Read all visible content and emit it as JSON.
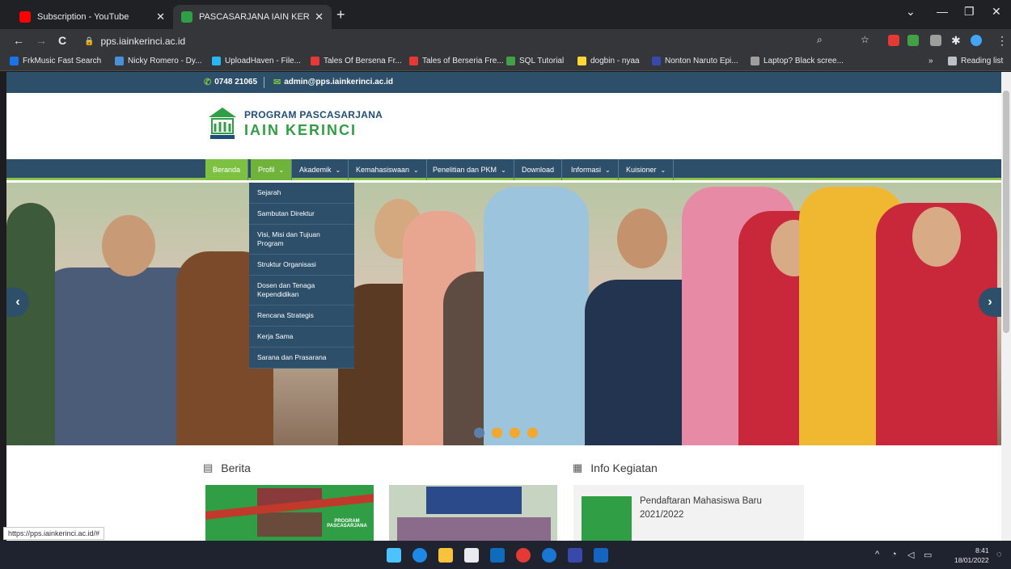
{
  "browser": {
    "tabs": [
      {
        "title": "Subscription - YouTube",
        "active": false
      },
      {
        "title": "PASCASARJANA IAIN KERINCI",
        "active": true
      }
    ],
    "new_tab": "+",
    "window_controls": {
      "minimize": "—",
      "maximize": "❐",
      "close": "✕",
      "overflow": "⌄"
    },
    "nav": {
      "back": "←",
      "forward": "→",
      "reload": "C"
    },
    "url": "pps.iainkerinci.ac.id",
    "bookmarks": [
      {
        "label": "FrkMusic Fast Search",
        "color": "#1a73e8"
      },
      {
        "label": "Nicky Romero - Dy...",
        "color": "#4a90d9"
      },
      {
        "label": "UploadHaven - File...",
        "color": "#29b6f6"
      },
      {
        "label": "Tales Of Bersena Fr...",
        "color": "#e53935"
      },
      {
        "label": "Tales of Berseria Fre...",
        "color": "#e53935"
      },
      {
        "label": "SQL Tutorial",
        "color": "#43a047"
      },
      {
        "label": "dogbin - nyaa",
        "color": "#fdd835"
      },
      {
        "label": "Nonton Naruto Epi...",
        "color": "#3949ab"
      },
      {
        "label": "Laptop? Black scree...",
        "color": "#9e9e9e"
      }
    ],
    "bookmarks_more": "»",
    "reading_list": "Reading list"
  },
  "site": {
    "phone": "0748 21065",
    "email": "admin@pps.iainkerinci.ac.id",
    "logo": {
      "line1": "PROGRAM PASCASARJANA",
      "line2": "IAIN KERINCI"
    },
    "nav": [
      {
        "label": "Beranda",
        "caret": false
      },
      {
        "label": "Profil",
        "caret": true
      },
      {
        "label": "Akademik",
        "caret": true
      },
      {
        "label": "Kemahasiswaan",
        "caret": true
      },
      {
        "label": "Penelitian dan PKM",
        "caret": true
      },
      {
        "label": "Download",
        "caret": false
      },
      {
        "label": "Informasi",
        "caret": true
      },
      {
        "label": "Kuisioner",
        "caret": true
      }
    ],
    "caret_glyph": "⌄",
    "profil_menu": [
      "Sejarah",
      "Sambutan Direktur",
      "Visi, Misi dan Tujuan Program",
      "Struktur Organisasi",
      "Dosen dan Tenaga Kependidikan",
      "Rencana Strategis",
      "Kerja Sama",
      "Sarana dan Prasarana"
    ],
    "carousel": {
      "prev": "‹",
      "next": "›",
      "slides": 4,
      "active_slide": 1
    },
    "berita_title": "Berita",
    "info_title": "Info Kegiatan",
    "info_items": [
      {
        "title": "Pendaftaran Mahasiswa Baru 2021/2022"
      }
    ],
    "thumb_caption": "PROGRAM PASCASARJANA"
  },
  "status_url": "https://pps.iainkerinci.ac.id/#",
  "taskbar": {
    "time": "8:41",
    "date": "18/01/2022"
  },
  "colors": {
    "navy": "#2d4f6a",
    "green": "#7dc143",
    "dot": "#f0a830"
  }
}
